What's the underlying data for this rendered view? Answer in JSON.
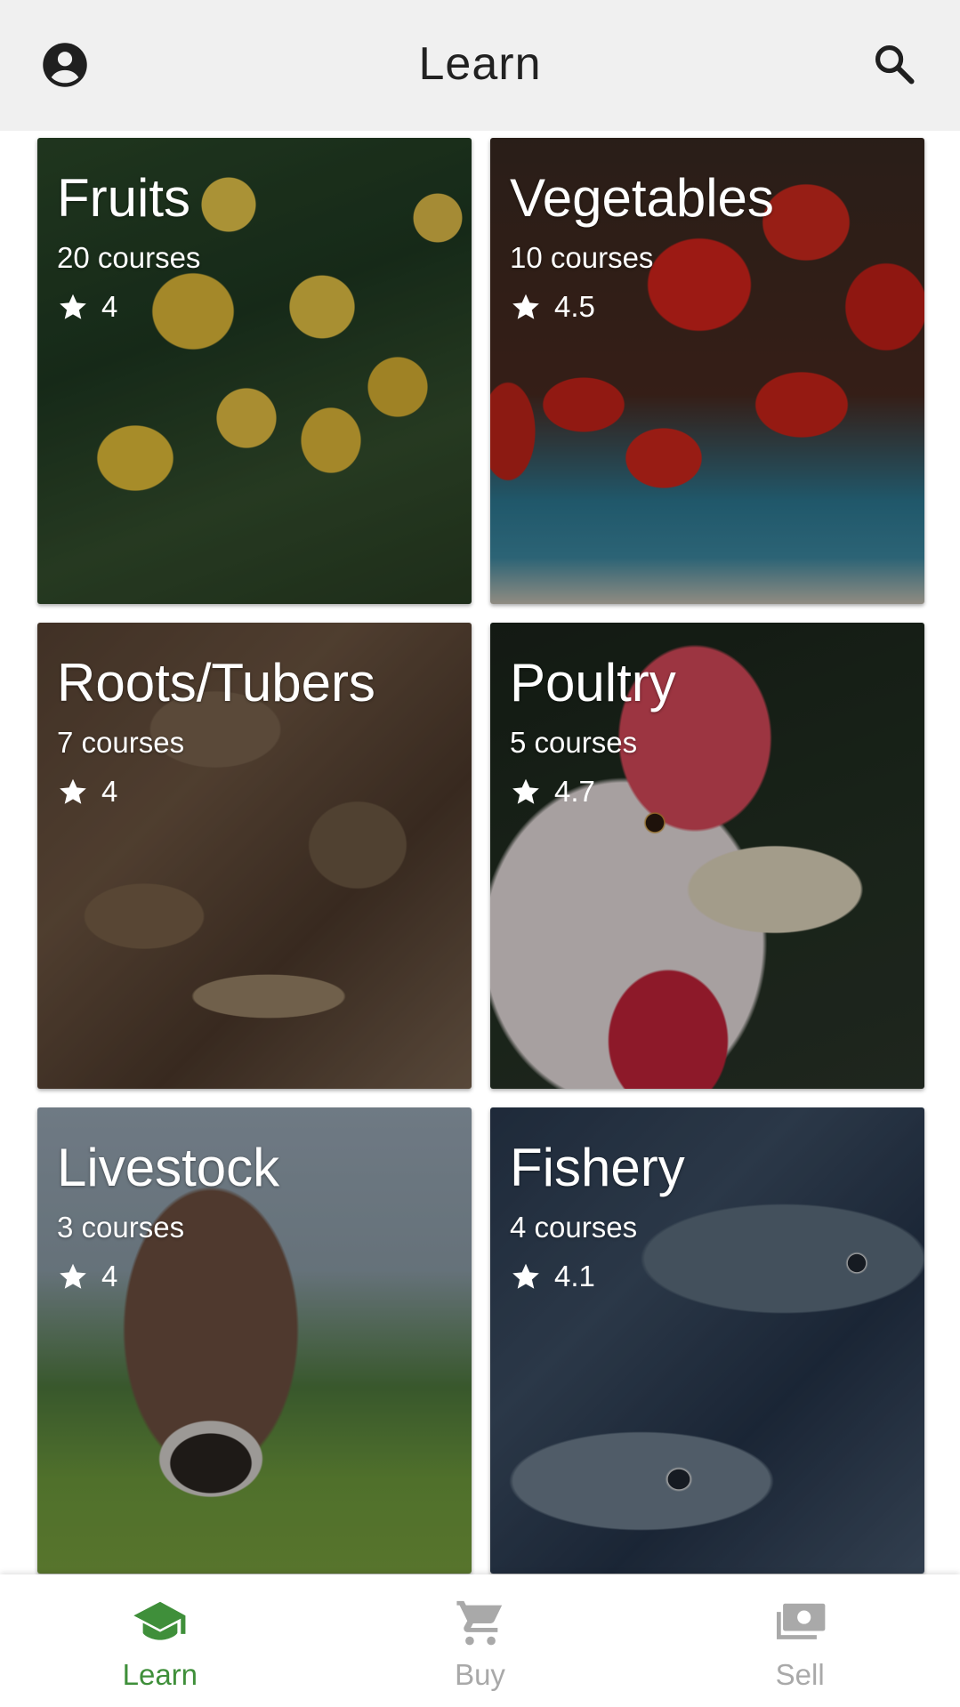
{
  "app_bar": {
    "title": "Learn",
    "left_icon": "account-circle-icon",
    "right_icon": "search-icon"
  },
  "categories": [
    {
      "title": "Fruits",
      "courses": "20 courses",
      "rating": "4"
    },
    {
      "title": "Vegetables",
      "courses": "10 courses",
      "rating": "4.5"
    },
    {
      "title": "Roots/Tubers",
      "courses": "7 courses",
      "rating": "4"
    },
    {
      "title": "Poultry",
      "courses": "5 courses",
      "rating": "4.7"
    },
    {
      "title": "Livestock",
      "courses": "3 courses",
      "rating": "4"
    },
    {
      "title": "Fishery",
      "courses": "4 courses",
      "rating": "4.1"
    }
  ],
  "bottom_nav": {
    "items": [
      {
        "label": "Learn",
        "icon": "graduation-cap-icon",
        "active": true
      },
      {
        "label": "Buy",
        "icon": "shopping-cart-icon",
        "active": false
      },
      {
        "label": "Sell",
        "icon": "money-icon",
        "active": false
      }
    ]
  },
  "colors": {
    "app_bar_bg": "#f0f0f0",
    "active_nav": "#3f8f3a",
    "inactive_nav": "#a9a9a9",
    "card_text": "#ffffff"
  }
}
